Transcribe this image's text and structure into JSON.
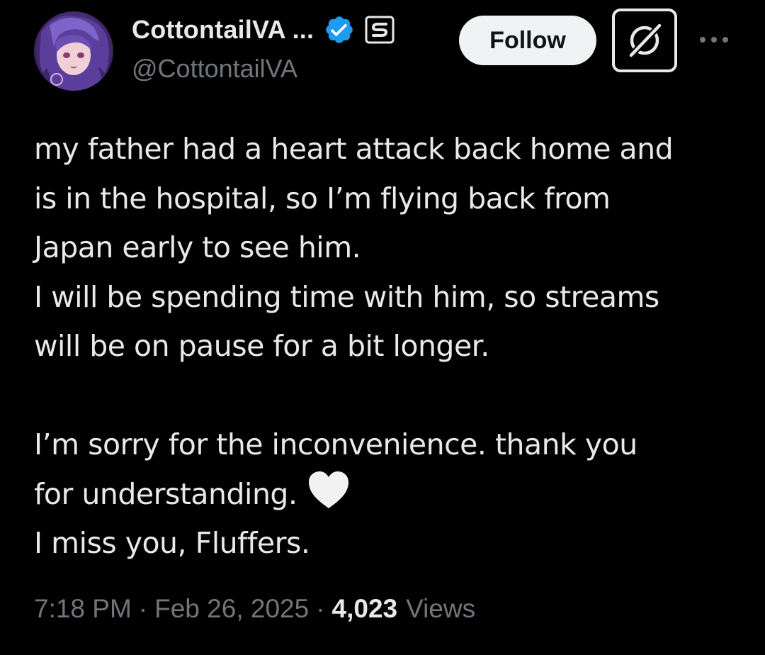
{
  "author": {
    "display_name": "CottontailVA ...",
    "handle": "@CottontailVA",
    "avatar_icon": "anime-avatar-purple-hair",
    "verified_icon": "verified-badge-icon",
    "verified_color": "#1d9bf0",
    "subscription_badge_icon": "subscription-badge-icon"
  },
  "actions": {
    "follow_label": "Follow",
    "grok_icon": "grok-icon",
    "more_icon": "more-dots-icon"
  },
  "tweet": {
    "lines": [
      "my father had a heart attack back home and",
      "is in the hospital, so I’m flying back from",
      "Japan early to see him.",
      "I will be spending time with him, so streams",
      "will be on pause for a bit longer.",
      "",
      "I’m sorry for the inconvenience. thank you",
      "for understanding.",
      "I miss you, Fluffers."
    ],
    "emoji": "white-heart-emoji"
  },
  "meta": {
    "time": "7:18 PM",
    "separator": "·",
    "date": "Feb 26, 2025",
    "views_count": "4,023",
    "views_label": "Views"
  },
  "colors": {
    "background": "#000000",
    "primary_text": "#e7e9ea",
    "secondary_text": "#71767b",
    "follow_button_bg": "#eff3f4"
  }
}
